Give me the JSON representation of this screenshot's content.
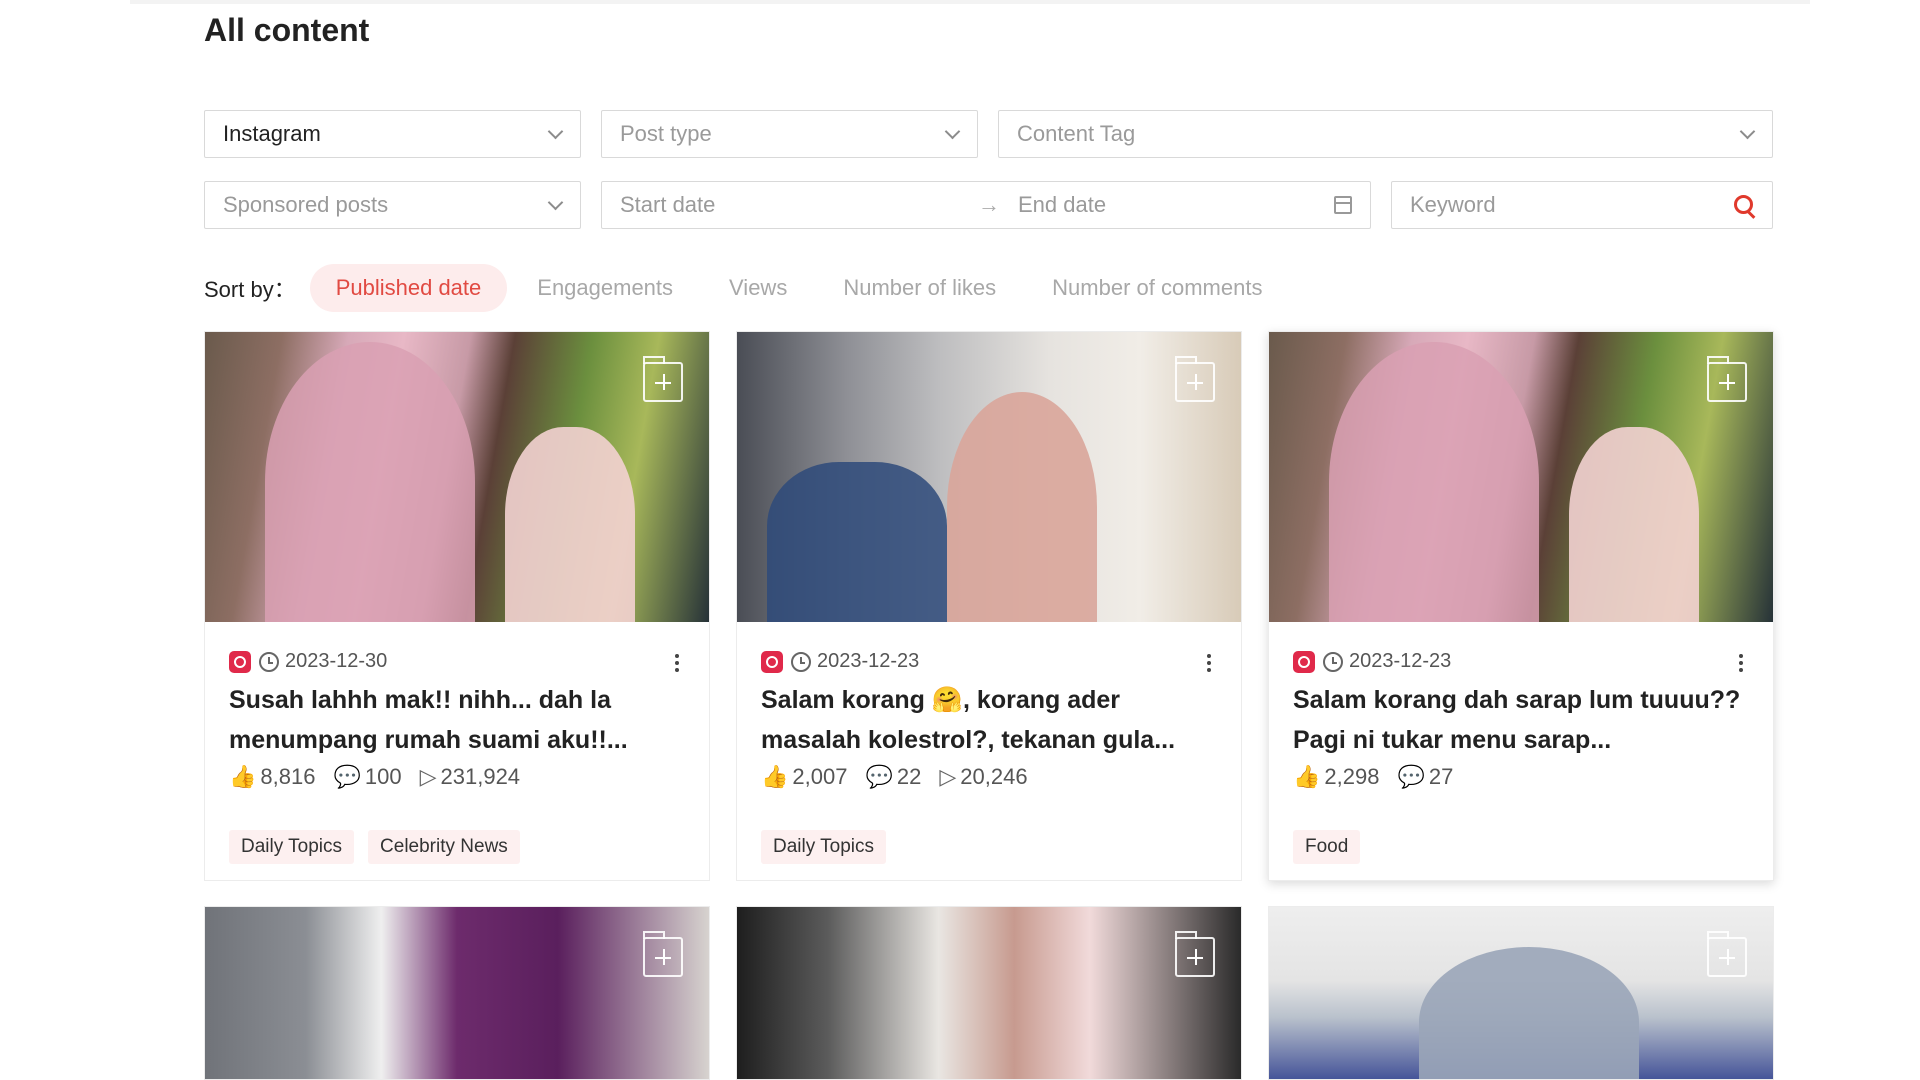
{
  "page": {
    "title": "All content"
  },
  "filters": {
    "platform": "Instagram",
    "post_type_placeholder": "Post type",
    "content_tag_placeholder": "Content Tag",
    "sponsored_placeholder": "Sponsored posts",
    "start_date_placeholder": "Start date",
    "date_arrow": "→",
    "end_date_placeholder": "End date",
    "keyword_placeholder": "Keyword"
  },
  "sort": {
    "label": "Sort by：",
    "options": [
      "Published date",
      "Engagements",
      "Views",
      "Number of likes",
      "Number of comments"
    ],
    "active": "Published date"
  },
  "icons": {
    "like": "👍",
    "comment": "💬",
    "play": "▷"
  },
  "cards": [
    {
      "date": "2023-12-30",
      "title": "Susah lahhh mak!! nihh... dah la menumpang rumah suami aku!!...",
      "likes": "8,816",
      "comments": "100",
      "views": "231,924",
      "tags": [
        "Daily Topics",
        "Celebrity News"
      ]
    },
    {
      "date": "2023-12-23",
      "title": "Salam korang 🤗, korang ader masalah kolestrol?, tekanan gula...",
      "likes": "2,007",
      "comments": "22",
      "views": "20,246",
      "tags": [
        "Daily Topics"
      ]
    },
    {
      "date": "2023-12-23",
      "title": "Salam korang dah sarap lum tuuuu?? Pagi ni tukar menu sarap...",
      "likes": "2,298",
      "comments": "27",
      "tags": [
        "Food"
      ]
    }
  ],
  "colors": {
    "accent": "#e14a42",
    "instagram": "#e0294a",
    "tag_bg": "#fdf0f0"
  }
}
